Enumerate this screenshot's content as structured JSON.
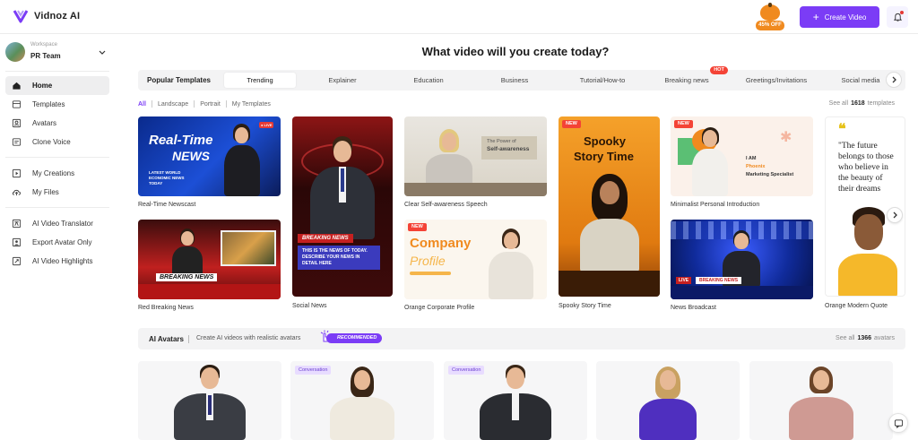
{
  "app": {
    "name": "Vidnoz AI"
  },
  "header": {
    "promo_badge": "45% OFF",
    "create_button": "Create Video"
  },
  "sidebar": {
    "workspace_label": "Workspace",
    "workspace_name": "PR Team",
    "items": [
      {
        "label": "Home",
        "icon": "home-icon"
      },
      {
        "label": "Templates",
        "icon": "templates-icon"
      },
      {
        "label": "Avatars",
        "icon": "avatars-icon"
      },
      {
        "label": "Clone Voice",
        "icon": "clone-voice-icon"
      },
      {
        "label": "My Creations",
        "icon": "play-icon"
      },
      {
        "label": "My Files",
        "icon": "upload-cloud-icon"
      },
      {
        "label": "AI Video Translator",
        "icon": "translate-icon"
      },
      {
        "label": "Export Avatar Only",
        "icon": "export-avatar-icon"
      },
      {
        "label": "AI Video Highlights",
        "icon": "highlights-icon"
      }
    ]
  },
  "main": {
    "headline": "What video will you create today?",
    "templates": {
      "title": "Popular Templates",
      "tabs": [
        "Trending",
        "Explainer",
        "Education",
        "Business",
        "Tutorial/How-to",
        "Breaking news",
        "Greetings/Invitations",
        "Social media"
      ],
      "hot_badge": "HOT",
      "filters": [
        "All",
        "Landscape",
        "Portrait",
        "My Templates"
      ],
      "see_all_prefix": "See all",
      "count": "1618",
      "see_all_suffix": "templates",
      "cards": [
        {
          "caption": "Real-Time Newscast",
          "title": "Real-Time",
          "title2": "NEWS",
          "sub": "LATEST WORLD ECONOMIC NEWS TODAY",
          "live": "● LIVE"
        },
        {
          "caption": "Red Breaking News",
          "banner": "BREAKING NEWS"
        },
        {
          "caption": "Social News",
          "banner": "BREAKING NEWS",
          "body": "THIS IS THE NEWS OF TODAY. DESCRIBE YOUR NEWS IN DETAIL HERE"
        },
        {
          "caption": "Clear Self-awareness Speech",
          "title": "The Power of",
          "title2": "Self-awareness"
        },
        {
          "caption": "Orange Corporate Profile",
          "new": "NEW",
          "title": "Company",
          "title2": "Profile"
        },
        {
          "caption": "Spooky Story Time",
          "new": "NEW",
          "title": "Spooky",
          "title2": "Story Time"
        },
        {
          "caption": "Minimalist Personal Introduction",
          "new": "NEW",
          "line1": "I AM",
          "line2": "Phoenix",
          "line3": "Marketing Specialist"
        },
        {
          "caption": "News Broadcast",
          "live": "LIVE",
          "banner": "BREAKING NEWS"
        },
        {
          "caption": "Orange Modern Quote",
          "quote": "\"The future belongs to those who believe in the beauty of their dreams"
        }
      ]
    },
    "avatars": {
      "title": "AI Avatars",
      "subtitle": "Create AI videos with realistic avatars",
      "recommended": "RECOMMENDED",
      "see_all_prefix": "See all",
      "count": "1366",
      "see_all_suffix": "avatars",
      "tag": "Conversation"
    }
  },
  "colors": {
    "accent": "#7b3cf6",
    "hot": "#f44336",
    "orange": "#f08a1f"
  }
}
